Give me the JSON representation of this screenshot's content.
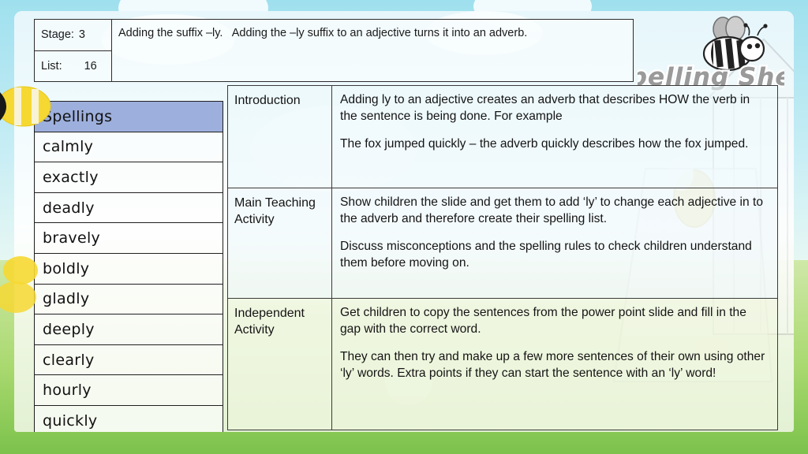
{
  "slide": {
    "frame_color_top": "#6ECBDE",
    "frame_color_bottom": "#6DBE45"
  },
  "header": {
    "stage_label": "Stage:",
    "stage_value": "3",
    "list_label": "List:",
    "list_value": "16",
    "title": "Adding the suffix –ly.   Adding the –ly suffix to an adjective turns it into an adverb."
  },
  "logo": {
    "text": "Spelling Shed",
    "bee_icon": "bee-icon"
  },
  "spellings": {
    "header": "Spellings",
    "header_color": "#9DAFDC",
    "words": [
      "calmly",
      "exactly",
      "deadly",
      "bravely",
      "boldly",
      "gladly",
      "deeply",
      "clearly",
      "hourly",
      "quickly"
    ]
  },
  "lesson": {
    "rows": [
      {
        "label": "Introduction",
        "paragraphs": [
          "Adding ly to an adjective creates an adverb that describes HOW the verb in the sentence is being done. For example",
          "The fox jumped quickly – the adverb quickly describes how the fox jumped."
        ]
      },
      {
        "label": "Main Teaching Activity",
        "paragraphs": [
          "Show children the slide and get them to add ‘ly’ to change each adjective in to the adverb and therefore create their spelling list.",
          "Discuss misconceptions and the spelling rules to check children understand them before moving on."
        ]
      },
      {
        "label": "Independent Activity",
        "paragraphs": [
          "Get children to copy the sentences from the power point slide and fill in the gap with the correct word.",
          "They can then try and make up a few more sentences of their own using other ‘ly’ words. Extra points if they can start the sentence with an ‘ly’ word!"
        ]
      }
    ]
  }
}
